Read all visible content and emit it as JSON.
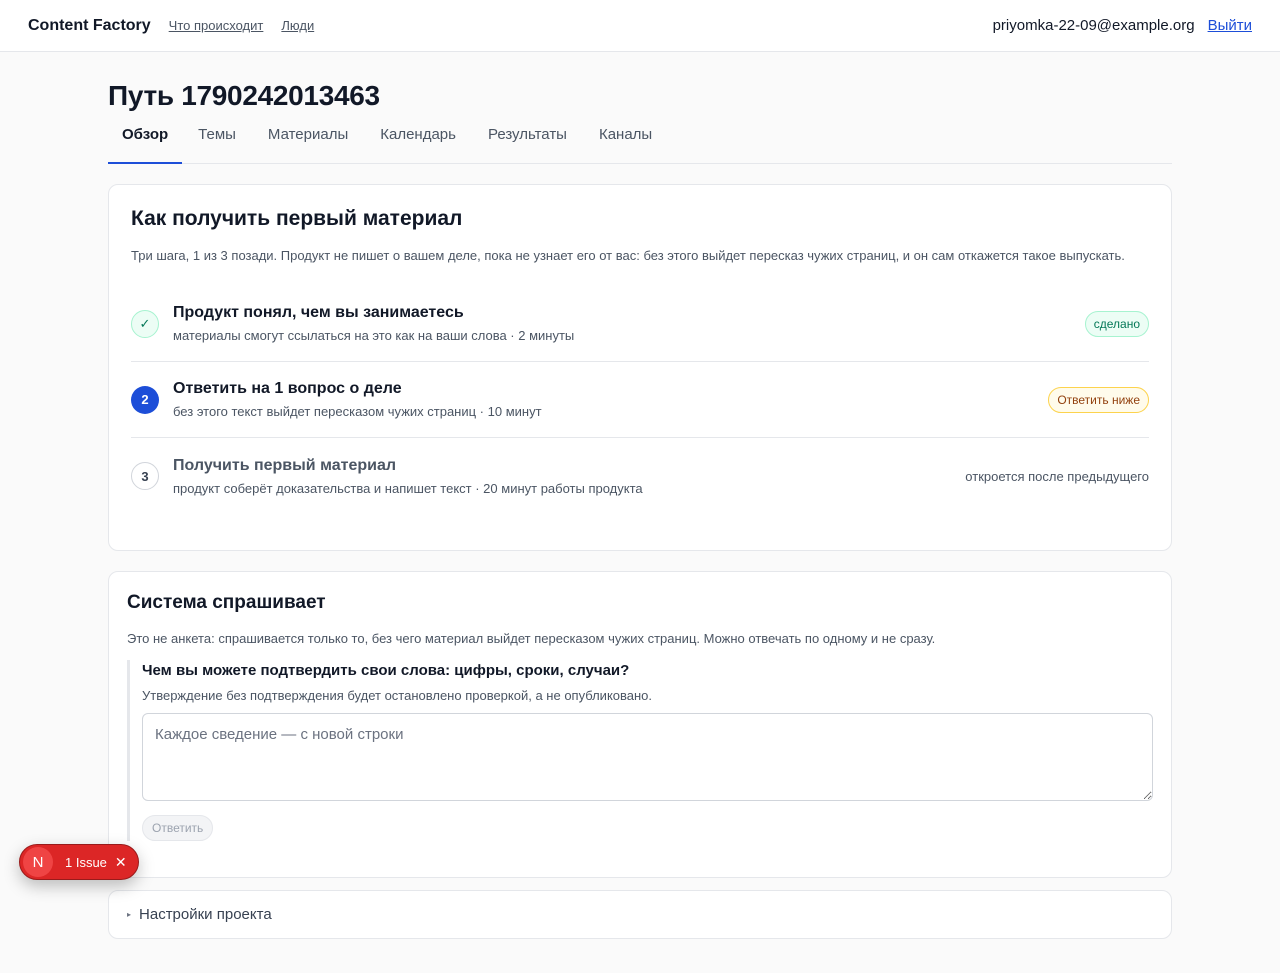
{
  "header": {
    "brand": "Content Factory",
    "nav": [
      "Что происходит",
      "Люди"
    ],
    "user_email": "priyomka-22-09@example.org",
    "logout_label": "Выйти"
  },
  "page": {
    "title": "Путь 1790242013463",
    "tabs": [
      "Обзор",
      "Темы",
      "Материалы",
      "Календарь",
      "Результаты",
      "Каналы"
    ],
    "active_tab": "Обзор"
  },
  "onboarding": {
    "title": "Как получить первый материал",
    "description": "Три шага, 1 из 3 позади. Продукт не пишет о вашем деле, пока не узнает его от вас: без этого выйдет пересказ чужих страниц, и он сам откажется такое выпускать.",
    "steps": [
      {
        "marker": "✓",
        "title": "Продукт понял, чем вы занимаетесь",
        "subtitle": "материалы смогут ссылаться на это как на ваши слова · 2 минуты",
        "status": "сделано"
      },
      {
        "marker": "2",
        "title": "Ответить на 1 вопрос о деле",
        "subtitle": "без этого текст выйдет пересказом чужих страниц · 10 минут",
        "status": "Ответить ниже"
      },
      {
        "marker": "3",
        "title": "Получить первый материал",
        "subtitle": "продукт соберёт доказательства и напишет текст · 20 минут работы продукта",
        "status": "откроется после предыдущего"
      }
    ]
  },
  "system_asks": {
    "title": "Система спрашивает",
    "description": "Это не анкета: спрашивается только то, без чего материал выйдет пересказом чужих страниц. Можно отвечать по одному и не сразу.",
    "question": "Чем вы можете подтвердить свои слова: цифры, сроки, случаи?",
    "hint": "Утверждение без подтверждения будет остановлено проверкой, а не опубликовано.",
    "placeholder": "Каждое сведение — с новой строки",
    "answer_button": "Ответить"
  },
  "settings": {
    "label": "Настройки проекта"
  },
  "issue_indicator": {
    "logo": "N",
    "label": "1 Issue",
    "close": "✕"
  }
}
